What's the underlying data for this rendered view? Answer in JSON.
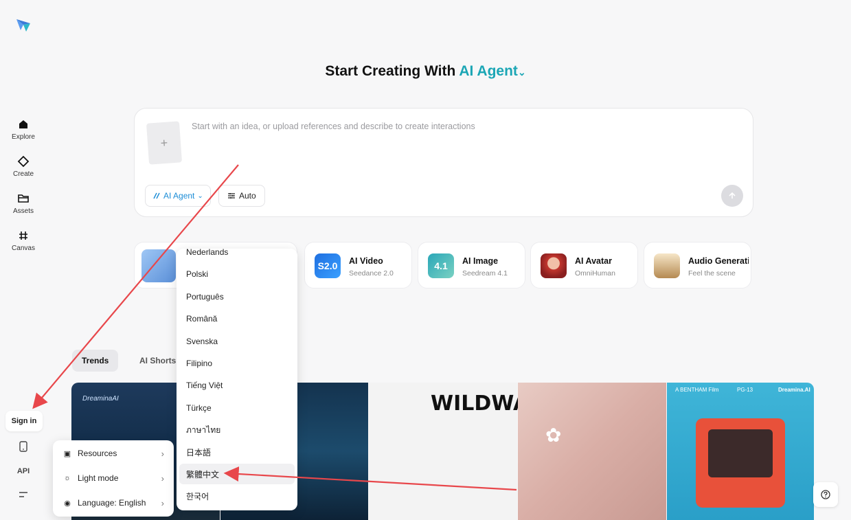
{
  "heading": {
    "prefix": "Start Creating With",
    "accent": "AI Agent",
    "chevron": "⌄"
  },
  "nav": [
    {
      "label": "Explore",
      "icon": "home-icon"
    },
    {
      "label": "Create",
      "icon": "diamond-icon"
    },
    {
      "label": "Assets",
      "icon": "folder-icon"
    },
    {
      "label": "Canvas",
      "icon": "hash-icon"
    }
  ],
  "sidebar_bottom": {
    "sign_in": "Sign in",
    "api": "API"
  },
  "prompt": {
    "placeholder": "Start with an idea, or upload references and describe to create interactions",
    "upload_glyph": "+",
    "agent_label": "AI Agent",
    "auto_label": "Auto"
  },
  "tools": [
    {
      "title": "AI Video",
      "subtitle": "Seedance 2.0",
      "badge": "S2.0"
    },
    {
      "title": "AI Image",
      "subtitle": "Seedream 4.1",
      "badge": "4.1"
    },
    {
      "title": "AI Avatar",
      "subtitle": "OmniHuman"
    },
    {
      "title": "Audio Generation",
      "subtitle": "Feel the scene"
    }
  ],
  "tabs": [
    "Trends",
    "AI Shorts"
  ],
  "gallery": {
    "brand": "DreaminaAI",
    "card3_text": "WILDWALN",
    "card5_left": "A BENTHAM Film",
    "card5_mid": "PG-13",
    "card5_right": "Dreamina.AI"
  },
  "settings_menu": [
    {
      "label": "Resources",
      "icon": "document-icon"
    },
    {
      "label": "Light mode",
      "icon": "sun-icon"
    },
    {
      "label": "Language: English",
      "icon": "globe-icon"
    }
  ],
  "languages": [
    "Nederlands",
    "Polski",
    "Português",
    "Română",
    "Svenska",
    "Filipino",
    "Tiếng Việt",
    "Türkçe",
    "ภาษาไทย",
    "日本語",
    "繁體中文",
    "한국어"
  ],
  "highlighted_language": "繁體中文",
  "colors": {
    "accent": "#1ba6b5",
    "annotation": "#e8474b"
  }
}
